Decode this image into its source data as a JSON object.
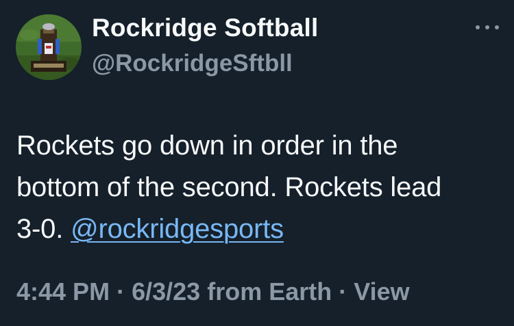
{
  "tweet": {
    "display_name": "Rockridge Softball",
    "handle": "@RockridgeSftbll",
    "avatar_icon": "trophy-on-grass",
    "more_icon": "more-dots-icon",
    "text_line1": "Rockets go down in order in the",
    "text_line2": "bottom of the second. Rockets lead",
    "text_line3": "3-0.",
    "mention": "@rockridgesports",
    "time": "4:44 PM",
    "separator": "·",
    "date": "6/3/23",
    "source": "from Earth",
    "view_label": "View"
  },
  "colors": {
    "background": "#15202b",
    "primary_text": "#f7f9f9",
    "secondary_text": "#8b98a5",
    "link": "#79b8f3"
  }
}
